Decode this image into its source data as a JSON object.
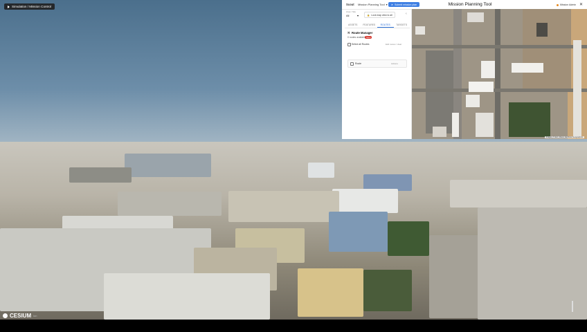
{
  "scene": {
    "top_button": {
      "label": "Simulation / Mission Control",
      "icon": "play-icon"
    },
    "cesium_logo": {
      "text": "CESIUM",
      "subtext": "ion"
    }
  },
  "panel": {
    "header": {
      "logo": "Scout",
      "mission_dropdown": "Mission Planning Tool",
      "primary_button": "Submit mission plan",
      "title": "Mission Planning Tool",
      "user": "Mission Admin"
    },
    "left": {
      "field_label": "Area / Site",
      "field_value": "All",
      "lock_button": "Lock map view to all",
      "tabs": [
        "ASSETS",
        "FEATURES",
        "ROUTES",
        "TARGETS"
      ],
      "active_tab": "ROUTES",
      "section_title": "Route Manager",
      "sub_text": "0 routes available",
      "save_badge": "Save",
      "check_label": "Select all Routes",
      "check_right": "Edit routes / clear",
      "card_label": "Route",
      "card_right": "Actions"
    },
    "map_attribution": "Imagery © Esri, Maxar, Earthstar Geographics"
  },
  "colors": {
    "accent": "#3e7fe3",
    "badge": "#d6372e",
    "user_status": "#e58a1f"
  }
}
